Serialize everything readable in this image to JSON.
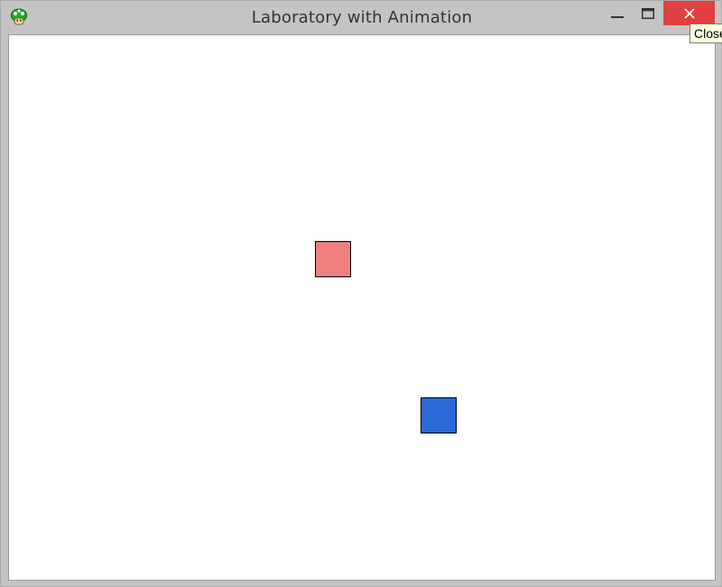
{
  "window": {
    "title": "Laboratory with Animation",
    "close_tooltip": "Close"
  },
  "icons": {
    "app": "green-mushroom-icon",
    "minimize": "minimize-icon",
    "maximize": "maximize-icon",
    "close": "close-icon"
  },
  "canvas": {
    "background": "#ffffff",
    "shapes": [
      {
        "name": "red-square",
        "color": "#f08080"
      },
      {
        "name": "blue-square",
        "color": "#2a69d8"
      }
    ]
  },
  "colors": {
    "close_button": "#e0403f",
    "frame": "#c4c4c4"
  }
}
